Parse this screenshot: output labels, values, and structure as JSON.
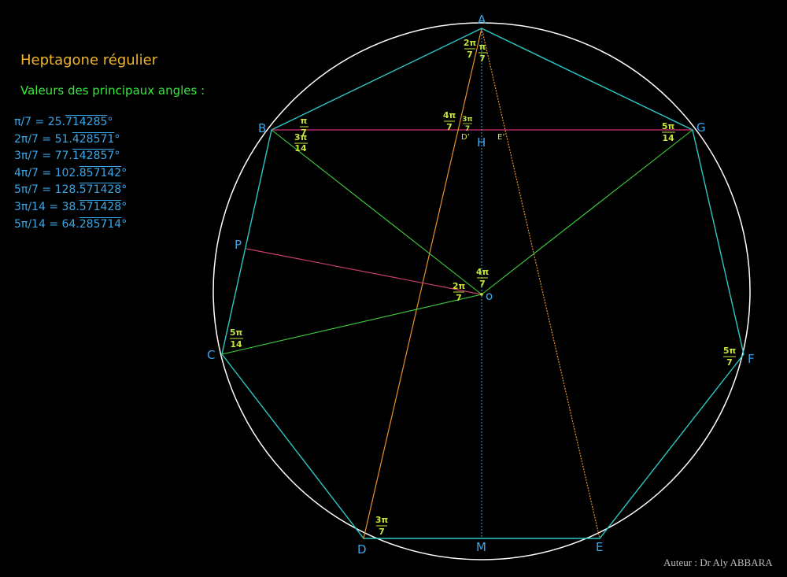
{
  "title": "Heptagone régulier",
  "subtitle": "Valeurs des principaux angles :",
  "angle_values": [
    {
      "lhs": "π/7 = ",
      "int": "25.",
      "rep": "714285",
      "deg": "°"
    },
    {
      "lhs": "2π/7 = ",
      "int": "51.",
      "rep": "428571",
      "deg": "°"
    },
    {
      "lhs": "3π/7 = ",
      "int": "77.",
      "rep": "142857",
      "deg": "°"
    },
    {
      "lhs": "4π/7 = ",
      "int": "102.",
      "rep": "857142",
      "deg": "°"
    },
    {
      "lhs": "5π/7 = ",
      "int": "128.",
      "rep": "571428",
      "deg": "°"
    },
    {
      "lhs": "3π/14 = ",
      "int": "38.",
      "rep": "571428",
      "deg": "°"
    },
    {
      "lhs": "5π/14 = ",
      "int": "64.",
      "rep": "285714",
      "deg": "°"
    }
  ],
  "author": "Auteur : Dr Aly ABBARA",
  "vertex_labels": {
    "A": "A",
    "B": "B",
    "C": "C",
    "D": "D",
    "E": "E",
    "F": "F",
    "G": "G",
    "O": "o",
    "H": "H",
    "M": "M",
    "P": "P",
    "Dp": "D’",
    "Ep": "E’"
  },
  "angle_marks": {
    "a_2pi7": [
      "2π",
      "7"
    ],
    "a_pi7": [
      "π",
      "7"
    ],
    "b_pi7": [
      "π",
      "7"
    ],
    "b_3pi14": [
      "3π",
      "14"
    ],
    "dp_4pi7": [
      "4π",
      "7"
    ],
    "dp_3pi7": [
      "3π",
      "7"
    ],
    "g_5pi14": [
      "5π",
      "14"
    ],
    "o_4pi7": [
      "4π",
      "7"
    ],
    "o_2pi7": [
      "2π",
      "7"
    ],
    "c_5pi14": [
      "5π",
      "14"
    ],
    "f_5pi7": [
      "5π",
      "7"
    ],
    "d_3pi7": [
      "3π",
      "7"
    ]
  },
  "colors": {
    "circle": "#ffffff",
    "heptagon": "#2ec7c7",
    "radii": "#3fd13f",
    "chord_BG": "#d6307a",
    "diagonals": "#e8902a",
    "axis": "#3aa6e8",
    "radius_OP": "#c83f6f"
  }
}
